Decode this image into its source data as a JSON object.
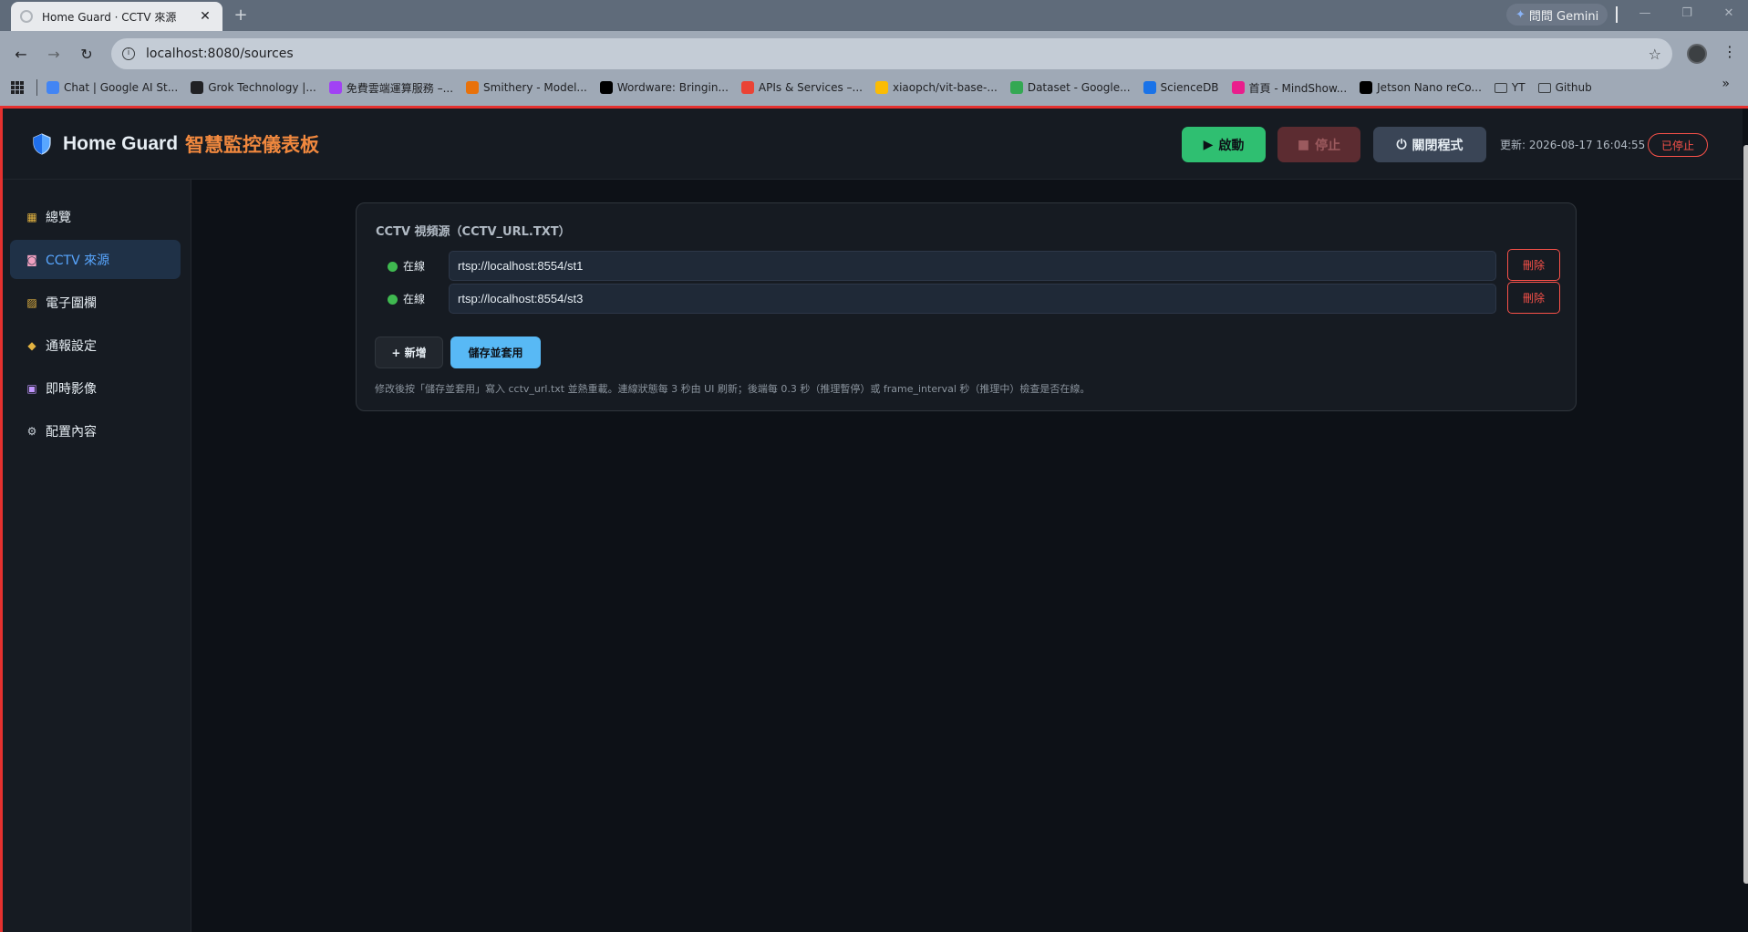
{
  "browser": {
    "tab_title": "Home Guard · CCTV 來源",
    "tab_close": "✕",
    "new_tab": "+",
    "gemini_label": "問問 Gemini",
    "window": {
      "minimize": "—",
      "restore": "❐",
      "close": "✕"
    },
    "nav": {
      "back": "←",
      "forward": "→",
      "reload": "↻"
    },
    "url": "localhost:8080/sources",
    "star": "☆",
    "kebab": "⋮",
    "bookmarks": [
      {
        "label": "Chat | Google AI St...",
        "icon": "ai-studio-icon",
        "color": "#4285f4"
      },
      {
        "label": "Grok Technology |...",
        "icon": "grok-icon",
        "color": "#202124"
      },
      {
        "label": "免費雲端運算服務 –...",
        "icon": "cube-icon",
        "color": "#a142f4"
      },
      {
        "label": "Smithery - Model...",
        "icon": "smithery-icon",
        "color": "#e8710a"
      },
      {
        "label": "Wordware: Bringin...",
        "icon": "wordware-icon",
        "color": "#000000"
      },
      {
        "label": "APIs & Services –...",
        "icon": "gcp-icon",
        "color": "#ea4335"
      },
      {
        "label": "xiaopch/vit-base-...",
        "icon": "huggingface-icon",
        "color": "#fbbc04"
      },
      {
        "label": "Dataset - Google...",
        "icon": "drive-icon",
        "color": "#34a853"
      },
      {
        "label": "ScienceDB",
        "icon": "sciencedb-icon",
        "color": "#1a73e8"
      },
      {
        "label": "首頁 - MindShow...",
        "icon": "mindshow-icon",
        "color": "#e91e8c"
      },
      {
        "label": "Jetson Nano reCo...",
        "icon": "medium-icon",
        "color": "#000000"
      },
      {
        "label": "YT",
        "icon": "folder-icon",
        "color": "transparent"
      },
      {
        "label": "Github",
        "icon": "folder-icon",
        "color": "transparent"
      }
    ],
    "bookmarks_more": "»"
  },
  "app": {
    "brand_title": "Home Guard",
    "brand_subtitle": "智慧監控儀表板",
    "controls": {
      "start_label": "啟動",
      "start_glyph": "▶",
      "stop_label": "停止",
      "stop_glyph": "■",
      "quit_label": "關閉程式",
      "quit_glyph": "⏻"
    },
    "updated_text": "更新: 2026-08-17 16:04:55",
    "status": "已停止",
    "colors": {
      "accent": "#58a6ff",
      "start": "#2fbf71",
      "danger": "#f85149",
      "brand_sub": "#f0883e"
    }
  },
  "sidebar": {
    "items": [
      {
        "label": "總覽",
        "glyph": "▦",
        "icon": "chart-icon",
        "color": "#e3b341"
      },
      {
        "label": "CCTV 來源",
        "glyph": "◙",
        "icon": "cctv-camera-icon",
        "color": "#f0a0c0",
        "active": true
      },
      {
        "label": "電子圍欄",
        "glyph": "▨",
        "icon": "fence-icon",
        "color": "#e3b341"
      },
      {
        "label": "通報設定",
        "glyph": "◆",
        "icon": "bell-icon",
        "color": "#e3b341"
      },
      {
        "label": "即時影像",
        "glyph": "▣",
        "icon": "video-icon",
        "color": "#c297ff"
      },
      {
        "label": "配置內容",
        "glyph": "⚙",
        "icon": "gear-icon",
        "color": "#c9d1d9"
      }
    ]
  },
  "sources": {
    "card_title": "CCTV 視頻源（CCTV_URL.TXT）",
    "rows": [
      {
        "status": "在線",
        "url": "rtsp://localhost:8554/st1",
        "delete_label": "刪除"
      },
      {
        "status": "在線",
        "url": "rtsp://localhost:8554/st3",
        "delete_label": "刪除"
      }
    ],
    "add_label": "+ 新增",
    "save_label": "儲存並套用",
    "hint": "修改後按「儲存並套用」寫入 cctv_url.txt 並熱重載。連線狀態每 3 秒由 UI 刷新；後端每 0.3 秒（推理暫停）或 frame_interval 秒（推理中）檢查是否在線。"
  }
}
